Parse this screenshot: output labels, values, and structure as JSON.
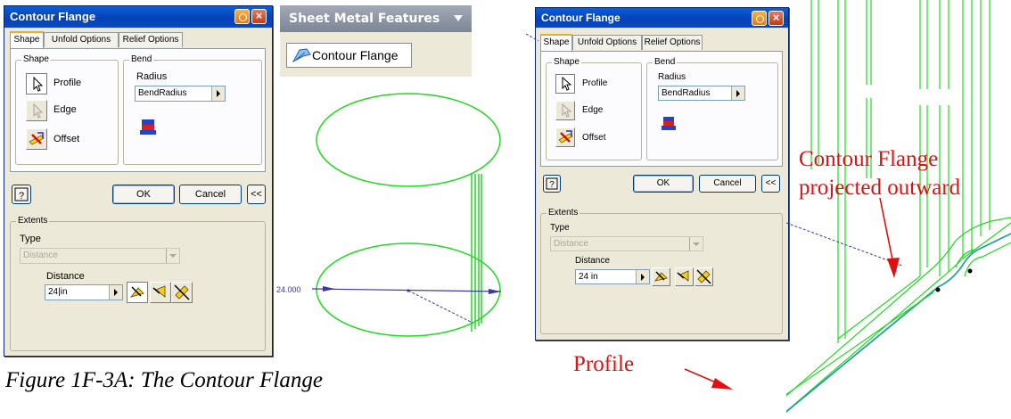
{
  "dialog": {
    "title": "Contour Flange",
    "tabs": [
      "Shape",
      "Unfold Options",
      "Relief Options"
    ],
    "shape_group": "Shape",
    "profile_label": "Profile",
    "edge_label": "Edge",
    "offset_label": "Offset",
    "bend_group": "Bend",
    "radius_label": "Radius",
    "radius_value": "BendRadius",
    "ok_label": "OK",
    "cancel_label": "Cancel",
    "more_label": "<<",
    "extents_group": "Extents",
    "type_label": "Type",
    "type_value": "Distance",
    "distance_label": "Distance",
    "distance_value_left": "24|in",
    "distance_value_right": "24 in"
  },
  "panel_bar": {
    "title": "Sheet Metal Features",
    "button_label": "Contour Flange"
  },
  "sketch": {
    "dimension": "24.000"
  },
  "annotations": {
    "contour_line1": "Contour Flange",
    "contour_line2": "projected outward",
    "profile": "Profile"
  },
  "caption": "Figure 1F-3A: The Contour Flange",
  "colors": {
    "green": "#22d822",
    "blue_dim": "#3838a8",
    "red_text": "#e01010"
  }
}
